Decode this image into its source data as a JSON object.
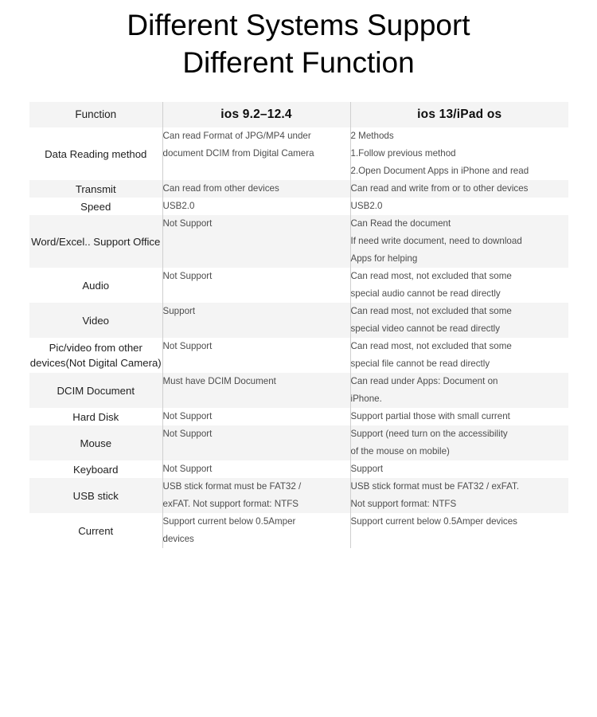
{
  "title": {
    "line1": "Different Systems Support",
    "line2": "Different Function"
  },
  "table": {
    "headers": {
      "function": "Function",
      "ios_old": "ios  9.2–12.4",
      "ios_new": "ios  13/iPad os"
    },
    "rows": [
      {
        "function": "Data Reading method",
        "old": [
          "Can read Format of JPG/MP4 under",
          "document DCIM from Digital Camera"
        ],
        "new": [
          "2 Methods",
          "1.Follow previous method",
          "2.Open Document Apps in iPhone and read"
        ]
      },
      {
        "function": "Transmit",
        "old": [
          "Can read from other devices"
        ],
        "new": [
          "Can read and write from or to other devices"
        ]
      },
      {
        "function": "Speed",
        "old": [
          "USB2.0"
        ],
        "new": [
          "USB2.0"
        ]
      },
      {
        "function": "Word/Excel.. Support Office",
        "old": [
          "Not Support"
        ],
        "new": [
          "Can Read the document",
          "If need write document, need to download",
          "Apps for helping"
        ]
      },
      {
        "function": "Audio",
        "old": [
          "Not Support"
        ],
        "new": [
          "Can read most, not excluded that some",
          "special audio cannot be read directly"
        ]
      },
      {
        "function": "Video",
        "old": [
          "Support"
        ],
        "new": [
          "Can read most, not excluded that some",
          "special video cannot be read directly"
        ]
      },
      {
        "function": "Pic/video from other devices(Not Digital Camera)",
        "old": [
          "Not Support"
        ],
        "new": [
          "Can read most, not excluded that some",
          "special file cannot be read directly"
        ]
      },
      {
        "function": "DCIM Document",
        "old": [
          "Must have DCIM Document"
        ],
        "new": [
          "Can read under Apps: Document on",
          "iPhone."
        ]
      },
      {
        "function": "Hard Disk",
        "old": [
          "Not Support"
        ],
        "new": [
          "Support partial those with small current"
        ]
      },
      {
        "function": "Mouse",
        "old": [
          "Not Support"
        ],
        "new": [
          "Support (need turn on the accessibility",
          "of the mouse on mobile)"
        ]
      },
      {
        "function": "Keyboard",
        "old": [
          "Not Support"
        ],
        "new": [
          "Support"
        ]
      },
      {
        "function": "USB stick",
        "old": [
          "USB stick format must be FAT32 /",
          "exFAT. Not support format: NTFS"
        ],
        "new": [
          "USB stick format must be FAT32 / exFAT.",
          "Not support format: NTFS"
        ]
      },
      {
        "function": "Current",
        "old": [
          "Support current below 0.5Amper",
          "devices"
        ],
        "new": [
          "Support current below 0.5Amper devices"
        ]
      }
    ]
  },
  "colors": {
    "shade_row": "#f4f4f4",
    "plain_row": "#ffffff",
    "divider": "#cfcfcf",
    "function_text": "#1f1f1f",
    "body_text": "#4d4d4d",
    "title_text": "#000000"
  }
}
